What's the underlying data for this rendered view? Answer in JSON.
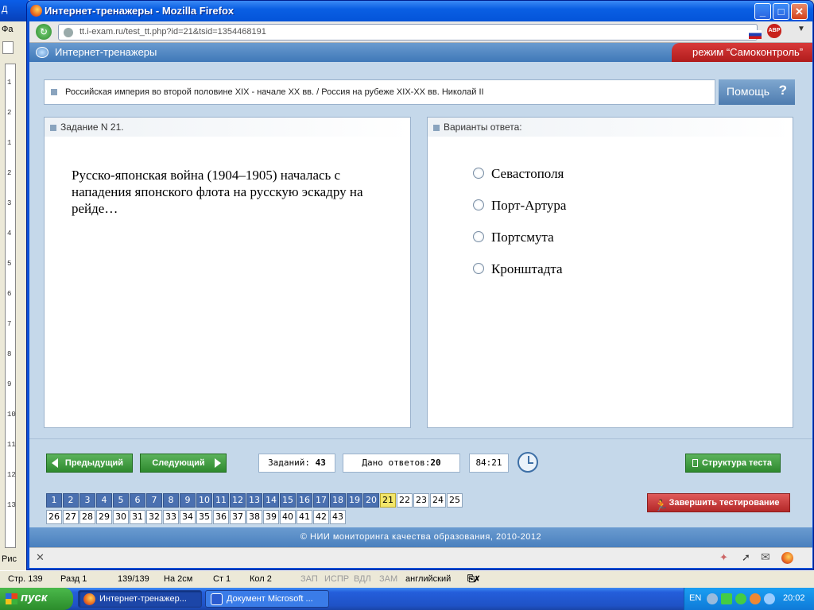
{
  "word": {
    "title_fragment": "Д",
    "menu_fragment": "Фа",
    "bottom_fragment": "Рис",
    "ruler_numbers": [
      "1",
      "2",
      "1",
      "2",
      "3",
      "4",
      "5",
      "6",
      "7",
      "8",
      "9",
      "10",
      "11",
      "12",
      "13"
    ],
    "status": {
      "page": "Стр. 139",
      "section": "Разд 1",
      "pages": "139/139",
      "at": "На 2см",
      "line": "Ст 1",
      "col": "Кол 2",
      "rec": "ЗАП",
      "trk": "ИСПР",
      "ext": "ВДЛ",
      "ovr": "ЗАМ",
      "lang": "английский"
    }
  },
  "browser": {
    "title": "Интернет-тренажеры - Mozilla Firefox",
    "url": "tt.i-exam.ru/test_tt.php?id=21&tsid=1354468191",
    "abp_label": "ABP"
  },
  "site": {
    "header_title": "Интернет-тренажеры",
    "mode_label": "режим “Самоконтроль”",
    "topic": "Российская империя во второй половине XIX - начале XX вв. / Россия на рубеже XIX-XX вв. Николай II",
    "help_label": "Помощь",
    "help_icon": "?",
    "task_header": "Задание N 21.",
    "question": "Русско-японская война (1904–1905) началась с нападения японского флота на русскую эскадру на рейде…",
    "answers_header": "Варианты ответа:",
    "options": [
      "Севастополя",
      "Порт-Артура",
      "Портсмута",
      "Кронштадта"
    ],
    "prev_label": "Предыдущий",
    "next_label": "Следующий",
    "tasks_label": "Заданий:",
    "tasks_count": "43",
    "answered_label": "Дано ответов:",
    "answered_count": "20",
    "timer": "84:21",
    "structure_label": "Структура теста",
    "finish_label": "Завершить тестирование",
    "current_question": 21,
    "answered_questions": 20,
    "total_questions": 43,
    "footer": "© НИИ мониторинга качества образования, 2010-2012"
  },
  "taskbar": {
    "start_label": "пуск",
    "tasks": [
      "Интернет-тренажер...",
      "Документ Microsoft ..."
    ],
    "lang": "EN",
    "time": "20:02"
  },
  "colors": {
    "answered": "#4a70b0",
    "current": "#f3e66a",
    "green_button": "#2e8a2e",
    "red_button": "#b32828",
    "header_blue": "#4a80be"
  }
}
